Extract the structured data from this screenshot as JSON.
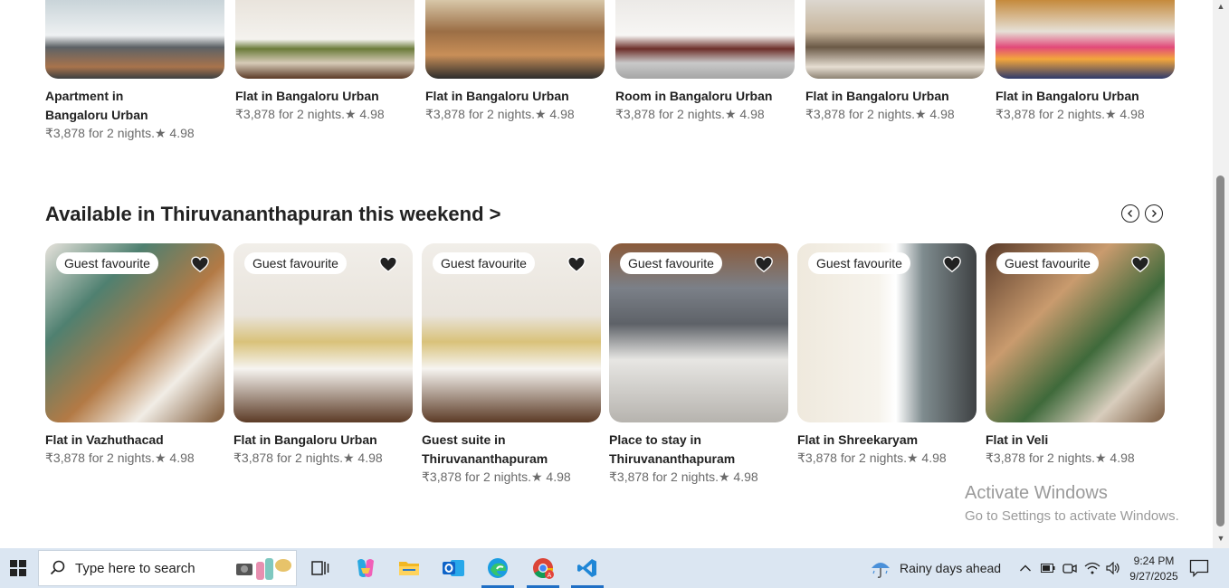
{
  "top_row": [
    {
      "title_lines": [
        "Apartment in",
        "Bangaloru Urban"
      ],
      "meta": "₹3,878 for 2 nights.★ 4.98"
    },
    {
      "title_lines": [
        "Flat in Bangaloru Urban"
      ],
      "meta": "₹3,878 for 2 nights.★ 4.98"
    },
    {
      "title_lines": [
        "Flat in Bangaloru Urban"
      ],
      "meta": "₹3,878 for 2 nights.★ 4.98"
    },
    {
      "title_lines": [
        "Room in Bangaloru Urban"
      ],
      "meta": "₹3,878 for 2 nights.★ 4.98"
    },
    {
      "title_lines": [
        "Flat in Bangaloru Urban"
      ],
      "meta": "₹3,878 for 2 nights.★ 4.98"
    },
    {
      "title_lines": [
        "Flat in Bangaloru Urban"
      ],
      "meta": "₹3,878 for 2 nights.★ 4.98"
    }
  ],
  "section": {
    "title": "Available in Thiruvananthapuran this weekend >",
    "listings": [
      {
        "badge": "Guest favourite",
        "title_lines": [
          "Flat in Vazhuthacad"
        ],
        "meta": "₹3,878 for 2 nights.★ 4.98"
      },
      {
        "badge": "Guest favourite",
        "title_lines": [
          "Flat in Bangaloru Urban"
        ],
        "meta": "₹3,878 for 2 nights.★ 4.98"
      },
      {
        "badge": "Guest favourite",
        "title_lines": [
          "Guest suite in",
          "Thiruvananthapuram"
        ],
        "meta": "₹3,878 for 2 nights.★ 4.98"
      },
      {
        "badge": "Guest favourite",
        "title_lines": [
          "Place to stay in",
          "Thiruvananthapuram"
        ],
        "meta": "₹3,878 for 2 nights.★ 4.98"
      },
      {
        "badge": "Guest favourite",
        "title_lines": [
          "Flat in Shreekaryam"
        ],
        "meta": "₹3,878 for 2 nights.★ 4.98"
      },
      {
        "badge": "Guest favourite",
        "title_lines": [
          "Flat in Veli"
        ],
        "meta": "₹3,878 for 2 nights.★ 4.98"
      }
    ]
  },
  "watermark": {
    "line1": "Activate Windows",
    "line2": "Go to Settings to activate Windows."
  },
  "taskbar": {
    "search_placeholder": "Type here to search",
    "weather": "Rainy days ahead",
    "time": "9:24 PM",
    "date": "9/27/2025",
    "icons": [
      "task-view-icon",
      "copilot-icon",
      "file-explorer-icon",
      "outlook-icon",
      "edge-icon",
      "chrome-icon",
      "vscode-icon"
    ]
  },
  "colors": {
    "taskbar": "#dbe6f2",
    "accent": "#1f6fc5",
    "heart": "#222222"
  }
}
